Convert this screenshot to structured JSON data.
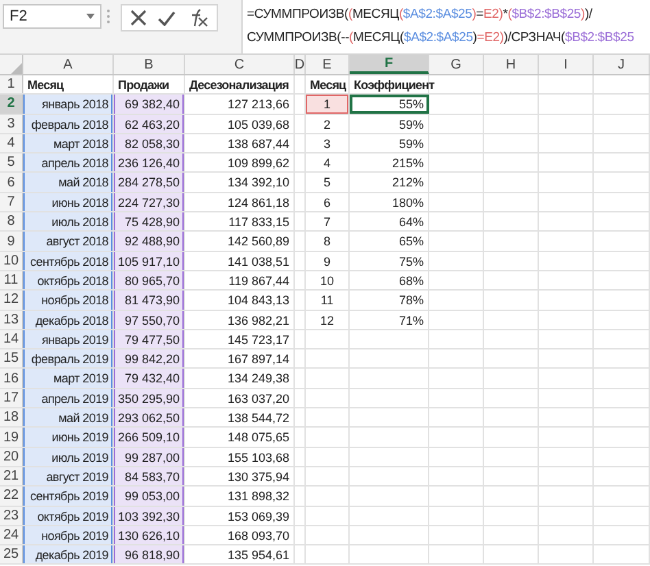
{
  "name_box": {
    "value": "F2"
  },
  "formula": {
    "lines": [
      [
        {
          "text": "=СУММПРОИЗВ("
        },
        {
          "text": "(",
          "color": "#e06666"
        },
        {
          "text": "МЕСЯЦ"
        },
        {
          "text": "(",
          "color": "#e06666"
        },
        {
          "text": "$A$2:$A$25",
          "color": "#5b8ee0"
        },
        {
          "text": ")",
          "color": "#e06666"
        },
        {
          "text": "="
        },
        {
          "text": "E2",
          "color": "#e06666"
        },
        {
          "text": ")",
          "color": "#e06666"
        },
        {
          "text": "*"
        },
        {
          "text": "(",
          "color": "#e06666"
        },
        {
          "text": "$B$2:$B$25",
          "color": "#9a6dd7"
        },
        {
          "text": ")",
          "color": "#e06666"
        },
        {
          "text": ")/"
        }
      ],
      [
        {
          "text": "СУММПРОИЗВ(--"
        },
        {
          "text": "(",
          "color": "#e06666"
        },
        {
          "text": "МЕСЯЦ("
        },
        {
          "text": "$A$2:$A$25",
          "color": "#5b8ee0"
        },
        {
          "text": ")"
        },
        {
          "text": "=E2",
          "color": "#e06666"
        },
        {
          "text": ")",
          "color": "#e06666"
        },
        {
          "text": ")/СРЗНАЧ("
        },
        {
          "text": "$B$2:$B$25",
          "color": "#9a6dd7"
        }
      ]
    ]
  },
  "columns": [
    {
      "letter": "A",
      "selected": false,
      "kind": "range",
      "color": "#5b8ee0"
    },
    {
      "letter": "B",
      "selected": false,
      "kind": "range",
      "color": "#9a6dd7"
    },
    {
      "letter": "C",
      "selected": false
    },
    {
      "letter": "D",
      "selected": false
    },
    {
      "letter": "E",
      "selected": false,
      "kind": "active_row",
      "color": "#e06666"
    },
    {
      "letter": "F",
      "selected": true,
      "kind": "active_cell",
      "color": "#217346"
    },
    {
      "letter": "G",
      "selected": false
    },
    {
      "letter": "H",
      "selected": false
    },
    {
      "letter": "I",
      "selected": false
    },
    {
      "letter": "J",
      "selected": false
    }
  ],
  "rows": [
    {
      "number": "1",
      "selected": false,
      "in_range": false,
      "cells": [
        "Месяц",
        "Продажи",
        "Десезонализация",
        null,
        "Месяц",
        "Коэффициент"
      ]
    },
    {
      "number": "2",
      "selected": true,
      "in_range": true,
      "cells": [
        "январь 2018",
        "69 382,40",
        "127 213,66",
        null,
        "1",
        "55%"
      ]
    },
    {
      "number": "3",
      "selected": false,
      "in_range": true,
      "cells": [
        "февраль 2018",
        "62 463,20",
        "105 039,68",
        null,
        "2",
        "59%"
      ]
    },
    {
      "number": "4",
      "selected": false,
      "in_range": true,
      "cells": [
        "март 2018",
        "82 058,30",
        "138 687,44",
        null,
        "3",
        "59%"
      ]
    },
    {
      "number": "5",
      "selected": false,
      "in_range": true,
      "cells": [
        "апрель 2018",
        "236 126,40",
        "109 899,62",
        null,
        "4",
        "215%"
      ]
    },
    {
      "number": "6",
      "selected": false,
      "in_range": true,
      "cells": [
        "май 2018",
        "284 278,50",
        "134 392,10",
        null,
        "5",
        "212%"
      ]
    },
    {
      "number": "7",
      "selected": false,
      "in_range": true,
      "cells": [
        "июнь 2018",
        "224 727,30",
        "124 861,18",
        null,
        "6",
        "180%"
      ]
    },
    {
      "number": "8",
      "selected": false,
      "in_range": true,
      "cells": [
        "июль 2018",
        "75 428,90",
        "117 833,15",
        null,
        "7",
        "64%"
      ]
    },
    {
      "number": "9",
      "selected": false,
      "in_range": true,
      "cells": [
        "август 2018",
        "92 488,90",
        "142 560,89",
        null,
        "8",
        "65%"
      ]
    },
    {
      "number": "10",
      "selected": false,
      "in_range": true,
      "cells": [
        "сентябрь 2018",
        "105 917,10",
        "141 038,51",
        null,
        "9",
        "75%"
      ]
    },
    {
      "number": "11",
      "selected": false,
      "in_range": true,
      "cells": [
        "октябрь 2018",
        "80 965,70",
        "119 867,44",
        null,
        "10",
        "68%"
      ]
    },
    {
      "number": "12",
      "selected": false,
      "in_range": true,
      "cells": [
        "ноябрь 2018",
        "81 473,90",
        "104 843,13",
        null,
        "11",
        "78%"
      ]
    },
    {
      "number": "13",
      "selected": false,
      "in_range": true,
      "cells": [
        "декабрь 2018",
        "97 550,70",
        "136 982,21",
        null,
        "12",
        "71%"
      ]
    },
    {
      "number": "14",
      "selected": false,
      "in_range": true,
      "cells": [
        "январь 2019",
        "79 477,50",
        "145 723,17"
      ]
    },
    {
      "number": "15",
      "selected": false,
      "in_range": true,
      "cells": [
        "февраль 2019",
        "99 842,20",
        "167 897,14"
      ]
    },
    {
      "number": "16",
      "selected": false,
      "in_range": true,
      "cells": [
        "март 2019",
        "79 432,40",
        "134 249,38"
      ]
    },
    {
      "number": "17",
      "selected": false,
      "in_range": true,
      "cells": [
        "апрель 2019",
        "350 295,90",
        "163 037,20"
      ]
    },
    {
      "number": "18",
      "selected": false,
      "in_range": true,
      "cells": [
        "май 2019",
        "293 062,50",
        "138 544,72"
      ]
    },
    {
      "number": "19",
      "selected": false,
      "in_range": true,
      "cells": [
        "июнь 2019",
        "266 509,10",
        "148 075,65"
      ]
    },
    {
      "number": "20",
      "selected": false,
      "in_range": true,
      "cells": [
        "июль 2019",
        "99 287,00",
        "155 103,68"
      ]
    },
    {
      "number": "21",
      "selected": false,
      "in_range": true,
      "cells": [
        "август 2019",
        "84 583,70",
        "130 375,94"
      ]
    },
    {
      "number": "22",
      "selected": false,
      "in_range": true,
      "cells": [
        "сентябрь 2019",
        "99 053,00",
        "131 898,32"
      ]
    },
    {
      "number": "23",
      "selected": false,
      "in_range": true,
      "cells": [
        "октябрь 2019",
        "103 392,30",
        "153 069,39"
      ]
    },
    {
      "number": "24",
      "selected": false,
      "in_range": true,
      "cells": [
        "ноябрь 2019",
        "130 626,10",
        "168 093,70"
      ]
    },
    {
      "number": "25",
      "selected": false,
      "in_range": true,
      "cells": [
        "декабрь 2019",
        "96 818,90",
        "135 954,61"
      ]
    }
  ]
}
